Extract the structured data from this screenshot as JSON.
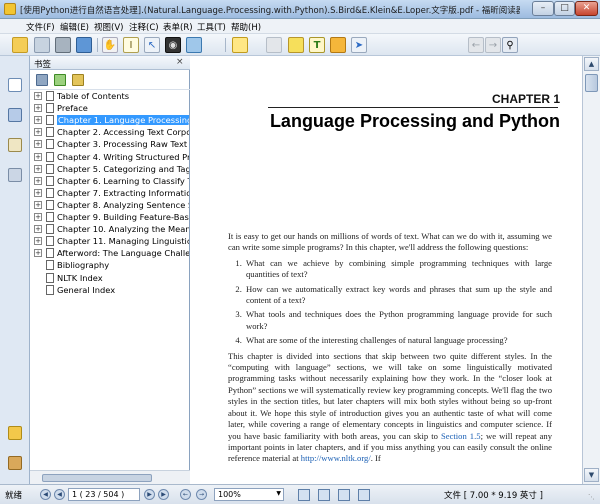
{
  "window": {
    "title": "[使用Python进行自然语言处理].(Natural.Language.Processing.with.Python).S.Bird&E.Klein&E.Loper.文字版.pdf - 福昕阅读器 - [[使用",
    "minimize": "–",
    "maximize": "□",
    "close": "✕"
  },
  "menu": [
    "文件(F)",
    "编辑(E)",
    "视图(V)",
    "注释(C)",
    "表单(R)",
    "工具(T)",
    "帮助(H)"
  ],
  "toolbar": {
    "search_placeholder": "查找",
    "icons": [
      "open-folder-icon",
      "save-icon",
      "print-icon",
      "email-icon",
      "hand-tool-icon",
      "select-text-icon",
      "select-annotation-icon",
      "find-icon",
      "snapshot-icon",
      "note-icon",
      "highlight-icon",
      "typewriter-icon",
      "comment-icon",
      "arrow-icon",
      "search-prev-icon",
      "search-next-icon",
      "zoom-icon"
    ]
  },
  "bookmarks": {
    "header": "书签",
    "close": "×",
    "items": [
      {
        "label": "Table of Contents",
        "expandable": true,
        "selected": false
      },
      {
        "label": "Preface",
        "expandable": true,
        "selected": false
      },
      {
        "label": "Chapter 1. Language Processing and Python",
        "expandable": true,
        "selected": true
      },
      {
        "label": "Chapter 2. Accessing Text Corpora and Lexical Resources",
        "expandable": true,
        "selected": false
      },
      {
        "label": "Chapter 3. Processing Raw Text",
        "expandable": true,
        "selected": false
      },
      {
        "label": "Chapter 4. Writing Structured Programs",
        "expandable": true,
        "selected": false
      },
      {
        "label": "Chapter 5. Categorizing and Tagging Words",
        "expandable": true,
        "selected": false
      },
      {
        "label": "Chapter 6. Learning to Classify Text",
        "expandable": true,
        "selected": false
      },
      {
        "label": "Chapter 7. Extracting Information from Text",
        "expandable": true,
        "selected": false
      },
      {
        "label": "Chapter 8. Analyzing Sentence Structure",
        "expandable": true,
        "selected": false
      },
      {
        "label": "Chapter 9. Building Feature-Based Grammars",
        "expandable": true,
        "selected": false
      },
      {
        "label": "Chapter 10. Analyzing the Meaning of Sentences",
        "expandable": true,
        "selected": false
      },
      {
        "label": "Chapter 11. Managing Linguistic Data",
        "expandable": true,
        "selected": false
      },
      {
        "label": "Afterword: The Language Challenge",
        "expandable": true,
        "selected": false
      },
      {
        "label": "Bibliography",
        "expandable": false,
        "selected": false
      },
      {
        "label": "NLTK Index",
        "expandable": false,
        "selected": false
      },
      {
        "label": "General Index",
        "expandable": false,
        "selected": false
      }
    ]
  },
  "document": {
    "chapter_label": "CHAPTER 1",
    "chapter_title": "Language Processing and Python",
    "intro": "It is easy to get our hands on millions of words of text. What can we do with it, assuming we can write some simple programs? In this chapter, we'll address the following questions:",
    "questions": [
      "What can we achieve by combining simple programming techniques with large quantities of text?",
      "How can we automatically extract key words and phrases that sum up the style and content of a text?",
      "What tools and techniques does the Python programming language provide for such work?",
      "What are some of the interesting challenges of natural language processing?"
    ],
    "para_part1": "This chapter is divided into sections that skip between two quite different styles. In the “computing with language” sections, we will take on some linguistically motivated programming tasks without necessarily explaining how they work. In the “closer look at Python” sections we will systematically review key programming concepts. We'll flag the two styles in the section titles, but later chapters will mix both styles without being so up-front about it. We hope this style of introduction gives you an authentic taste of what will come later, while covering a range of elementary concepts in linguistics and computer science. If you have basic familiarity with both areas, you can skip to",
    "section_link": "Section 1.5",
    "para_part2": "; we will repeat any important points in later chapters, and if you miss anything you can easily consult the online reference material at",
    "url_link": "http://www.nltk.org/",
    "para_part3": ". If"
  },
  "status": {
    "ready": "就绪",
    "page": "1 ( 23 / 504 )",
    "zoom": "100%",
    "doc_size": "文件 [ 7.00 * 9.19 英寸 ]"
  },
  "colors": {
    "selection": "#3399ff",
    "link": "#1a5fb4"
  }
}
